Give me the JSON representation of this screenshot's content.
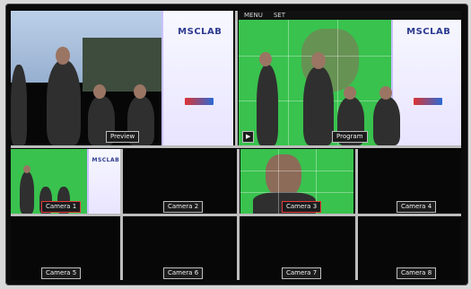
{
  "multiview": {
    "preview": {
      "label": "Preview"
    },
    "program": {
      "label": "Program"
    },
    "program_menu": {
      "items": [
        "MENU",
        "SET"
      ]
    },
    "cameras": [
      {
        "label": "Camera 1"
      },
      {
        "label": "Camera 2"
      },
      {
        "label": "Camera 3"
      },
      {
        "label": "Camera 4"
      },
      {
        "label": "Camera 5"
      },
      {
        "label": "Camera 6"
      },
      {
        "label": "Camera 7"
      },
      {
        "label": "Camera 8"
      }
    ]
  },
  "colors": {
    "bezel": "#0b0b0b",
    "tally_red": "#e33b3b",
    "tally_green": "#39c24e",
    "label_bg": "#1c1c1c"
  }
}
